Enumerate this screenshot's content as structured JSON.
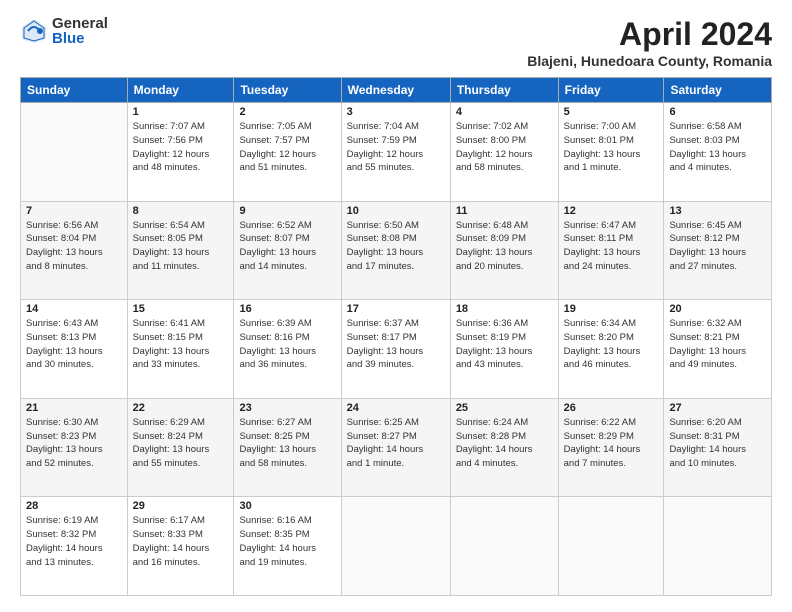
{
  "logo": {
    "general": "General",
    "blue": "Blue"
  },
  "title": "April 2024",
  "subtitle": "Blajeni, Hunedoara County, Romania",
  "weekdays": [
    "Sunday",
    "Monday",
    "Tuesday",
    "Wednesday",
    "Thursday",
    "Friday",
    "Saturday"
  ],
  "weeks": [
    [
      {
        "day": "",
        "info": ""
      },
      {
        "day": "1",
        "info": "Sunrise: 7:07 AM\nSunset: 7:56 PM\nDaylight: 12 hours\nand 48 minutes."
      },
      {
        "day": "2",
        "info": "Sunrise: 7:05 AM\nSunset: 7:57 PM\nDaylight: 12 hours\nand 51 minutes."
      },
      {
        "day": "3",
        "info": "Sunrise: 7:04 AM\nSunset: 7:59 PM\nDaylight: 12 hours\nand 55 minutes."
      },
      {
        "day": "4",
        "info": "Sunrise: 7:02 AM\nSunset: 8:00 PM\nDaylight: 12 hours\nand 58 minutes."
      },
      {
        "day": "5",
        "info": "Sunrise: 7:00 AM\nSunset: 8:01 PM\nDaylight: 13 hours\nand 1 minute."
      },
      {
        "day": "6",
        "info": "Sunrise: 6:58 AM\nSunset: 8:03 PM\nDaylight: 13 hours\nand 4 minutes."
      }
    ],
    [
      {
        "day": "7",
        "info": "Sunrise: 6:56 AM\nSunset: 8:04 PM\nDaylight: 13 hours\nand 8 minutes."
      },
      {
        "day": "8",
        "info": "Sunrise: 6:54 AM\nSunset: 8:05 PM\nDaylight: 13 hours\nand 11 minutes."
      },
      {
        "day": "9",
        "info": "Sunrise: 6:52 AM\nSunset: 8:07 PM\nDaylight: 13 hours\nand 14 minutes."
      },
      {
        "day": "10",
        "info": "Sunrise: 6:50 AM\nSunset: 8:08 PM\nDaylight: 13 hours\nand 17 minutes."
      },
      {
        "day": "11",
        "info": "Sunrise: 6:48 AM\nSunset: 8:09 PM\nDaylight: 13 hours\nand 20 minutes."
      },
      {
        "day": "12",
        "info": "Sunrise: 6:47 AM\nSunset: 8:11 PM\nDaylight: 13 hours\nand 24 minutes."
      },
      {
        "day": "13",
        "info": "Sunrise: 6:45 AM\nSunset: 8:12 PM\nDaylight: 13 hours\nand 27 minutes."
      }
    ],
    [
      {
        "day": "14",
        "info": "Sunrise: 6:43 AM\nSunset: 8:13 PM\nDaylight: 13 hours\nand 30 minutes."
      },
      {
        "day": "15",
        "info": "Sunrise: 6:41 AM\nSunset: 8:15 PM\nDaylight: 13 hours\nand 33 minutes."
      },
      {
        "day": "16",
        "info": "Sunrise: 6:39 AM\nSunset: 8:16 PM\nDaylight: 13 hours\nand 36 minutes."
      },
      {
        "day": "17",
        "info": "Sunrise: 6:37 AM\nSunset: 8:17 PM\nDaylight: 13 hours\nand 39 minutes."
      },
      {
        "day": "18",
        "info": "Sunrise: 6:36 AM\nSunset: 8:19 PM\nDaylight: 13 hours\nand 43 minutes."
      },
      {
        "day": "19",
        "info": "Sunrise: 6:34 AM\nSunset: 8:20 PM\nDaylight: 13 hours\nand 46 minutes."
      },
      {
        "day": "20",
        "info": "Sunrise: 6:32 AM\nSunset: 8:21 PM\nDaylight: 13 hours\nand 49 minutes."
      }
    ],
    [
      {
        "day": "21",
        "info": "Sunrise: 6:30 AM\nSunset: 8:23 PM\nDaylight: 13 hours\nand 52 minutes."
      },
      {
        "day": "22",
        "info": "Sunrise: 6:29 AM\nSunset: 8:24 PM\nDaylight: 13 hours\nand 55 minutes."
      },
      {
        "day": "23",
        "info": "Sunrise: 6:27 AM\nSunset: 8:25 PM\nDaylight: 13 hours\nand 58 minutes."
      },
      {
        "day": "24",
        "info": "Sunrise: 6:25 AM\nSunset: 8:27 PM\nDaylight: 14 hours\nand 1 minute."
      },
      {
        "day": "25",
        "info": "Sunrise: 6:24 AM\nSunset: 8:28 PM\nDaylight: 14 hours\nand 4 minutes."
      },
      {
        "day": "26",
        "info": "Sunrise: 6:22 AM\nSunset: 8:29 PM\nDaylight: 14 hours\nand 7 minutes."
      },
      {
        "day": "27",
        "info": "Sunrise: 6:20 AM\nSunset: 8:31 PM\nDaylight: 14 hours\nand 10 minutes."
      }
    ],
    [
      {
        "day": "28",
        "info": "Sunrise: 6:19 AM\nSunset: 8:32 PM\nDaylight: 14 hours\nand 13 minutes."
      },
      {
        "day": "29",
        "info": "Sunrise: 6:17 AM\nSunset: 8:33 PM\nDaylight: 14 hours\nand 16 minutes."
      },
      {
        "day": "30",
        "info": "Sunrise: 6:16 AM\nSunset: 8:35 PM\nDaylight: 14 hours\nand 19 minutes."
      },
      {
        "day": "",
        "info": ""
      },
      {
        "day": "",
        "info": ""
      },
      {
        "day": "",
        "info": ""
      },
      {
        "day": "",
        "info": ""
      }
    ]
  ]
}
